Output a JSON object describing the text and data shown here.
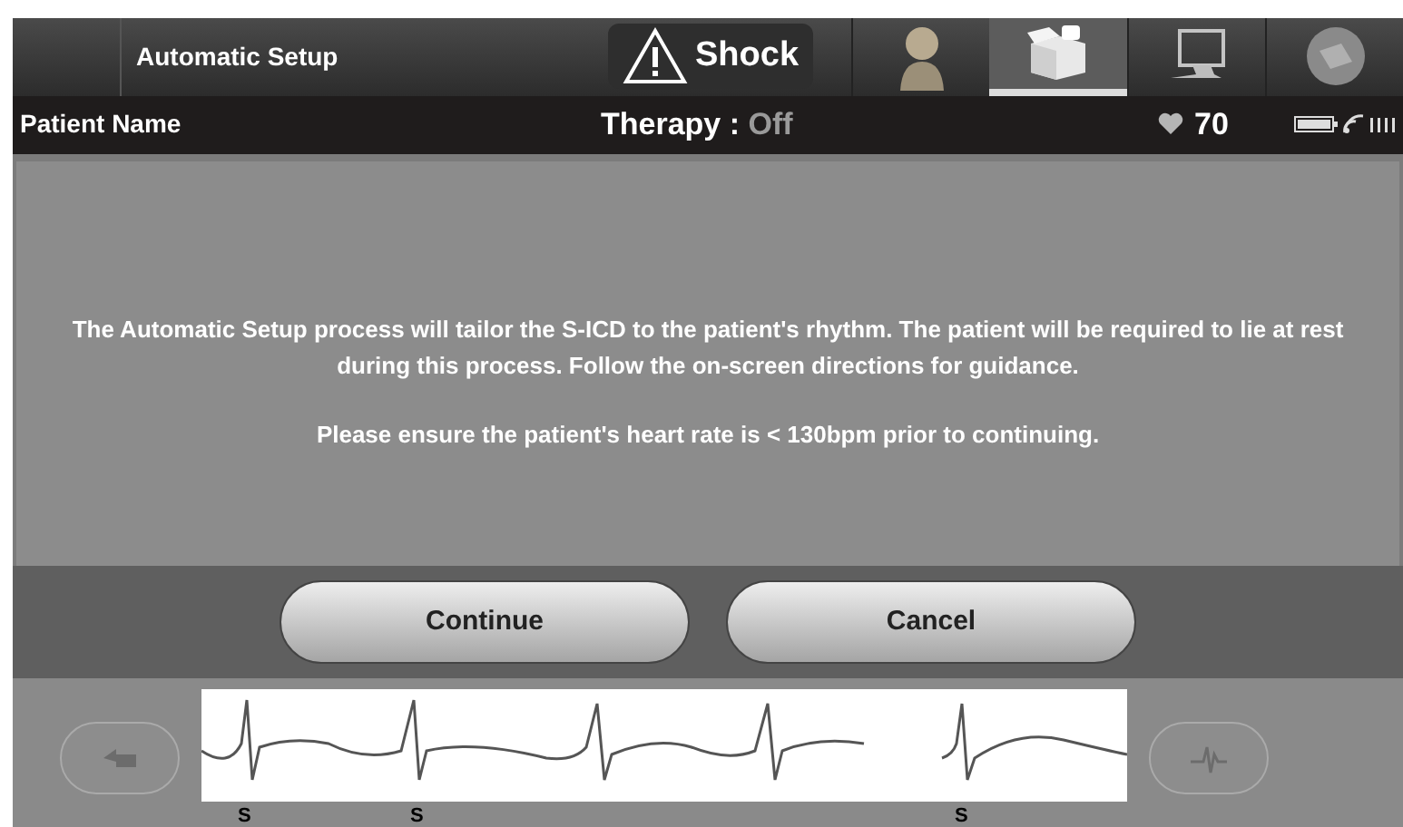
{
  "header": {
    "title": "Automatic Setup",
    "shock_button": "Shock",
    "nav": [
      {
        "kind": "person",
        "selected": false
      },
      {
        "kind": "box",
        "selected": true
      },
      {
        "kind": "monitor",
        "selected": false
      },
      {
        "kind": "disc",
        "selected": false
      }
    ]
  },
  "status_bar": {
    "patient": "Patient Name",
    "therapy_label": "Therapy :",
    "therapy_value": "Off",
    "heart_rate": "70"
  },
  "message": [
    "The Automatic Setup process will tailor the S-ICD to the patient's rhythm. The patient will be required to lie at rest during this process. Follow the on-screen directions for guidance.",
    "Please ensure the patient's heart rate is < 130bpm prior to continuing."
  ],
  "buttons": [
    "Continue",
    "Cancel"
  ],
  "ecg": {
    "markers": [
      "S",
      "S",
      "S"
    ]
  }
}
